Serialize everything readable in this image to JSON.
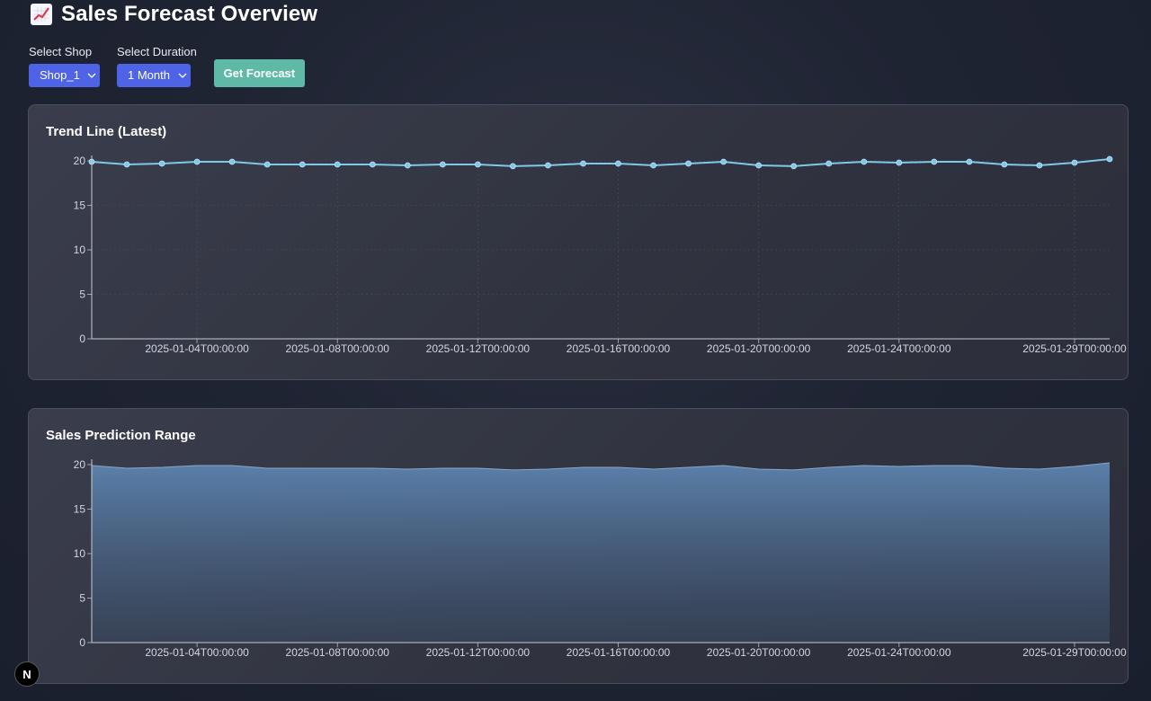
{
  "header": {
    "title": "Sales Forecast Overview",
    "icon": "chart-increasing-icon"
  },
  "controls": {
    "shop_label": "Select Shop",
    "shop_value": "Shop_1",
    "duration_label": "Select Duration",
    "duration_value": "1 Month",
    "forecast_button": "Get Forecast"
  },
  "colors": {
    "accent": "#4e63e6",
    "button": "#5ebaa7",
    "line": "#7fc8e8"
  },
  "badge": {
    "label": "N"
  },
  "chart_data": [
    {
      "type": "line",
      "title": "Trend Line (Latest)",
      "x": [
        "2025-01-01",
        "2025-01-02",
        "2025-01-03",
        "2025-01-04",
        "2025-01-05",
        "2025-01-06",
        "2025-01-07",
        "2025-01-08",
        "2025-01-09",
        "2025-01-10",
        "2025-01-11",
        "2025-01-12",
        "2025-01-13",
        "2025-01-14",
        "2025-01-15",
        "2025-01-16",
        "2025-01-17",
        "2025-01-18",
        "2025-01-19",
        "2025-01-20",
        "2025-01-21",
        "2025-01-22",
        "2025-01-23",
        "2025-01-24",
        "2025-01-25",
        "2025-01-26",
        "2025-01-27",
        "2025-01-28",
        "2025-01-29",
        "2025-01-30"
      ],
      "values": [
        19.9,
        19.6,
        19.7,
        19.9,
        19.9,
        19.6,
        19.6,
        19.6,
        19.6,
        19.5,
        19.6,
        19.6,
        19.4,
        19.5,
        19.7,
        19.7,
        19.5,
        19.7,
        19.9,
        19.5,
        19.4,
        19.7,
        19.9,
        19.8,
        19.9,
        19.9,
        19.6,
        19.5,
        19.8,
        20.2
      ],
      "xticks": [
        "2025-01-04T00:00:00",
        "2025-01-08T00:00:00",
        "2025-01-12T00:00:00",
        "2025-01-16T00:00:00",
        "2025-01-20T00:00:00",
        "2025-01-24T00:00:00",
        "2025-01-29T00:00:00"
      ],
      "yticks": [
        "0",
        "5",
        "10",
        "15",
        "20"
      ],
      "ylim": [
        0,
        20
      ],
      "grid": true
    },
    {
      "type": "area",
      "title": "Sales Prediction Range",
      "x": [
        "2025-01-01",
        "2025-01-02",
        "2025-01-03",
        "2025-01-04",
        "2025-01-05",
        "2025-01-06",
        "2025-01-07",
        "2025-01-08",
        "2025-01-09",
        "2025-01-10",
        "2025-01-11",
        "2025-01-12",
        "2025-01-13",
        "2025-01-14",
        "2025-01-15",
        "2025-01-16",
        "2025-01-17",
        "2025-01-18",
        "2025-01-19",
        "2025-01-20",
        "2025-01-21",
        "2025-01-22",
        "2025-01-23",
        "2025-01-24",
        "2025-01-25",
        "2025-01-26",
        "2025-01-27",
        "2025-01-28",
        "2025-01-29",
        "2025-01-30"
      ],
      "values": [
        19.9,
        19.6,
        19.7,
        19.9,
        19.9,
        19.6,
        19.6,
        19.6,
        19.6,
        19.5,
        19.6,
        19.6,
        19.4,
        19.5,
        19.7,
        19.7,
        19.5,
        19.7,
        19.9,
        19.5,
        19.4,
        19.7,
        19.9,
        19.8,
        19.9,
        19.9,
        19.6,
        19.5,
        19.8,
        20.2
      ],
      "xticks": [
        "2025-01-04T00:00:00",
        "2025-01-08T00:00:00",
        "2025-01-12T00:00:00",
        "2025-01-16T00:00:00",
        "2025-01-20T00:00:00",
        "2025-01-24T00:00:00",
        "2025-01-29T00:00:00"
      ],
      "yticks": [
        "0",
        "5",
        "10",
        "15",
        "20"
      ],
      "ylim": [
        0,
        20
      ],
      "grid": false
    }
  ]
}
